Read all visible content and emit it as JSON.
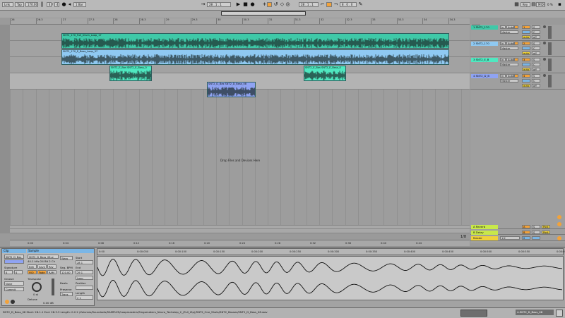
{
  "transport": {
    "link": "Link",
    "tap": "Tap",
    "tempo": "170.00",
    "sig_num": "4",
    "sig_den": "4",
    "quantize": "1 Bar",
    "position": "28 . 1 . 1",
    "loop_start": "28 . 1 . 1",
    "loop_len": "8 . 0 . 0",
    "key": "Key",
    "midi": "MIDI",
    "cpu": "0 %"
  },
  "ruler": [
    "26",
    "26.3",
    "27",
    "27.3",
    "28",
    "28.3",
    "29",
    "29.3",
    "30",
    "30.3",
    "31",
    "31.3",
    "32",
    "32.3",
    "33",
    "33.3",
    "34",
    "34.3"
  ],
  "tracks": [
    {
      "name": "1 SNT2_170",
      "clip_title": "SNT2_170_Full_Drum_Loop_17",
      "color": "#3fc9a8",
      "io": "In",
      "auto": "Auto",
      "route": "Master",
      "vol": "1",
      "pan": "C"
    },
    {
      "name": "2 SNT2_170",
      "clip_title": "SNT2_170_E_Bass_Loop_37",
      "color": "#8fc9f2",
      "io": "In",
      "auto": "Auto",
      "route": "Master",
      "vol": "2",
      "pan": "C"
    },
    {
      "name": "3 SNT2_E_B",
      "clip_title_a": "SNT2_E_Bas SNT2_E_Bass_0",
      "clip_title_b": "SNT2_E_Bas SNT2_E_Bass_0",
      "color": "#4fe8c0",
      "io": "In",
      "auto": "Auto",
      "route": "Master",
      "vol": "3",
      "pan": "C"
    },
    {
      "name": "4 SNT2_D_B",
      "clip_title": "SNT2_D_Bas SNT2_D_Bass_08",
      "color": "#8fa3f2",
      "io": "In",
      "auto": "Auto",
      "route": "Master",
      "vol": "4",
      "pan": "C"
    }
  ],
  "returns": [
    {
      "name": "A Reverb",
      "letter": "A",
      "color": "#c8e84a"
    },
    {
      "name": "B Delay",
      "letter": "B",
      "color": "#c8e84a"
    }
  ],
  "master": {
    "name": "Master",
    "route": "1/2",
    "value": "0"
  },
  "arrangement": {
    "drop_text": "Drop Files and Devices Here",
    "counter": "1/8"
  },
  "timeline": [
    "0:00",
    "0:04",
    "0:08",
    "0:12",
    "0:16",
    "0:20",
    "0:24",
    "0:28",
    "0:32",
    "0:36",
    "0:40",
    "0:44"
  ],
  "clip_detail": {
    "clip_tab": "Clip",
    "sample_tab": "Sample",
    "clip_name": "SNT2_D_Bas",
    "sample_name": "SNT2_D_Bass_08.w",
    "sample_info": "44.1 kHz 24 Bit 2 Ch",
    "signature": "Signature",
    "sig_a": "4",
    "sig_b": "4",
    "groove": "Groove",
    "groove_val": "None",
    "commit": "Commit",
    "warp": "Warp",
    "edit": "Edit",
    "save": "Save",
    "rev": "Rev",
    "hiq": "HiQ",
    "fade": "Fade",
    "ram": "RAM",
    "seg_bpm_label": "Seg. BPM",
    "seg_bpm": "120.00",
    "start_label": "Start",
    "start_val": "28 1",
    "end_label": "End",
    "end_val": "29 1",
    "loop_label": "Loop",
    "position_label": "Position",
    "length_label": "Length",
    "length_val": "2 1",
    "transpose_label": "Transpose",
    "transpose_val": "0 st",
    "detune_label": "Detune",
    "detune_val": "0.00 dB",
    "beats_label": "Beats",
    "preserve_label": "Preserve",
    "trans_label": "Trans",
    "scale": [
      "0:00",
      "0:00:050",
      "0:00:100",
      "0:00:150",
      "0:00:200",
      "0:00:250",
      "0:00:300",
      "0:00:350",
      "0:00:400",
      "0:00:450",
      "0:00:500",
      "0:00:550",
      "0:00:600"
    ]
  },
  "status": {
    "text": "SNT2_D_Bass_08 Start: 28.1.1 End: 28.3.3 Length: 0.2.2 /Volumes/Soundsets/SAMPLES/Loopmasters/Singomakers_Neuro_Techstep_2_(Full_Zip)/SNT2_One_Shots/SNT2_Basses/SNT2_D_Bass_08.wav",
    "right_label": "4-SNT2_D_Bass_08"
  },
  "colors": {
    "accent": "#f2a23a",
    "drum": "#3fc9a8",
    "bass": "#8fc9f2",
    "ebass": "#4fe8c0",
    "dbass": "#8fa3f2"
  }
}
